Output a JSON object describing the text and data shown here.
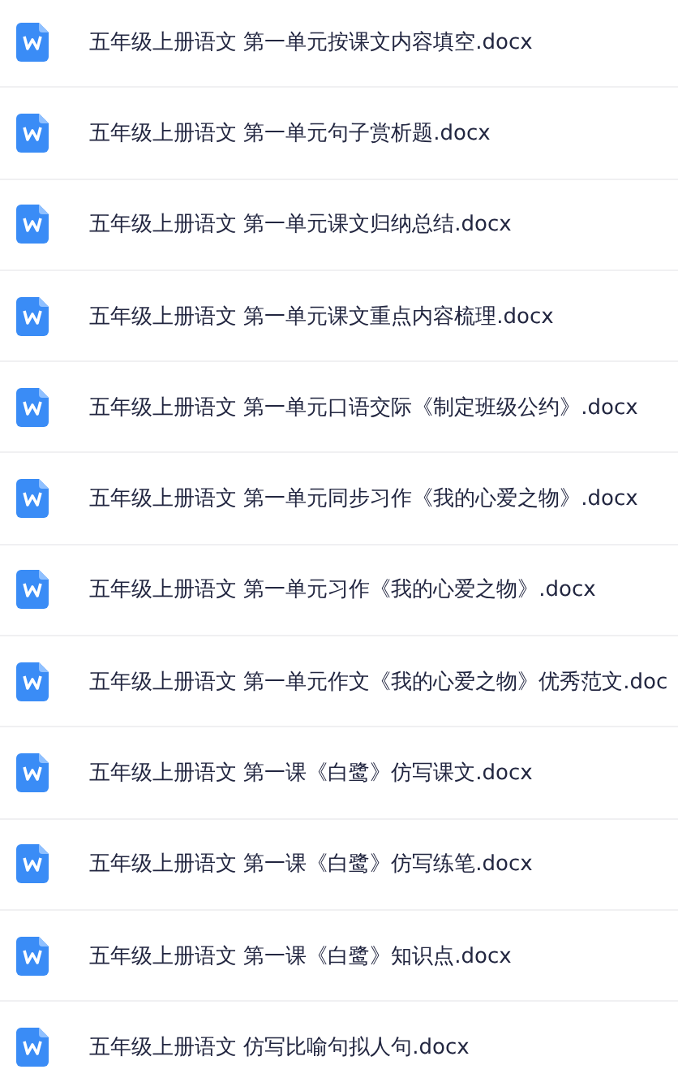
{
  "files": [
    {
      "name": "五年级上册语文 第一单元按课文内容填空.docx"
    },
    {
      "name": "五年级上册语文 第一单元句子赏析题.docx"
    },
    {
      "name": "五年级上册语文 第一单元课文归纳总结.docx"
    },
    {
      "name": "五年级上册语文 第一单元课文重点内容梳理.docx"
    },
    {
      "name": "五年级上册语文 第一单元口语交际《制定班级公约》.docx"
    },
    {
      "name": "五年级上册语文 第一单元同步习作《我的心爱之物》.docx"
    },
    {
      "name": "五年级上册语文 第一单元习作《我的心爱之物》.docx"
    },
    {
      "name": "五年级上册语文 第一单元作文《我的心爱之物》优秀范文.doc"
    },
    {
      "name": "五年级上册语文 第一课《白鹭》仿写课文.docx"
    },
    {
      "name": "五年级上册语文 第一课《白鹭》仿写练笔.docx"
    },
    {
      "name": "五年级上册语文 第一课《白鹭》知识点.docx"
    },
    {
      "name": "五年级上册语文 仿写比喻句拟人句.docx"
    }
  ]
}
